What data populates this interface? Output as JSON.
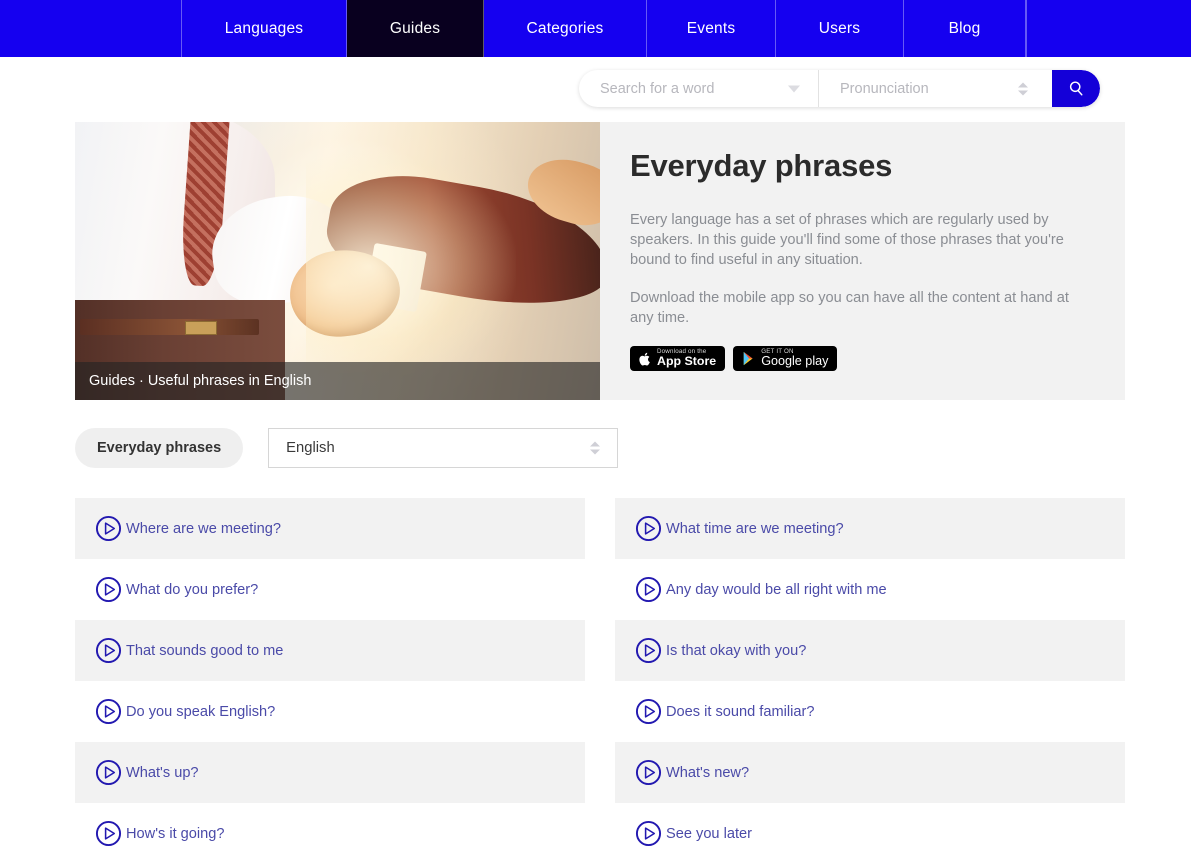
{
  "colors": {
    "nav_blue": "#1500f0",
    "nav_active": "#09001f",
    "search_button_blue": "#1400d8",
    "phrase_link": "#4a4aa8",
    "row_alt_bg": "#f2f2f2",
    "panel_bg": "#f2f2f2"
  },
  "nav": {
    "items": [
      {
        "label": "Languages",
        "active": false,
        "width": 165
      },
      {
        "label": "Guides",
        "active": true,
        "width": 137
      },
      {
        "label": "Categories",
        "active": false,
        "width": 163
      },
      {
        "label": "Events",
        "active": false,
        "width": 129
      },
      {
        "label": "Users",
        "active": false,
        "width": 128
      },
      {
        "label": "Blog",
        "active": false,
        "width": 122
      }
    ]
  },
  "search": {
    "word_placeholder": "Search for a word",
    "word_value": "",
    "pronunciation_placeholder": "Pronunciation",
    "pronunciation_value": "",
    "word_dropdown_icon": "chevron-down-icon",
    "pronunciation_spinner_icon": "spinner-updown-icon",
    "button_icon": "search-icon"
  },
  "hero": {
    "image_caption": "Guides · Useful phrases in English",
    "image_alt": "two people shaking hands",
    "title": "Everyday phrases",
    "paragraph_1": "Every language has a set of phrases which are regularly used by speakers. In this guide you'll find some of those phrases that you're bound to find useful in any situation.",
    "paragraph_2": "Download the mobile app so you can have all the content at hand at any time.",
    "badges": [
      {
        "icon": "apple-icon",
        "sub": "Download on the",
        "main": "App Store"
      },
      {
        "icon": "google-play-icon",
        "sub": "GET IT ON",
        "main": "Google play"
      }
    ]
  },
  "filters": {
    "guide_pill": "Everyday phrases",
    "language_select_value": "English",
    "language_select_icon": "spinner-updown-icon"
  },
  "phrases": {
    "play_icon": "play-circle-icon",
    "left_column": [
      "Where are we meeting?",
      "What do you prefer?",
      "That sounds good to me",
      "Do you speak English?",
      "What's up?",
      "How's it going?"
    ],
    "right_column": [
      "What time are we meeting?",
      "Any day would be all right with me",
      "Is that okay with you?",
      "Does it sound familiar?",
      "What's new?",
      "See you later"
    ]
  }
}
